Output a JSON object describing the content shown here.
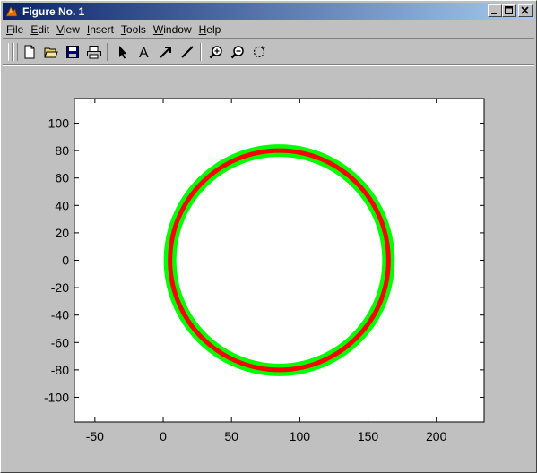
{
  "window": {
    "title": "Figure No. 1",
    "title_gradient": [
      "#0a246a",
      "#a6caf0"
    ],
    "controls": [
      {
        "name": "minimize",
        "icon": "minimize-icon"
      },
      {
        "name": "maximize",
        "icon": "maximize-icon"
      },
      {
        "name": "close",
        "icon": "close-icon"
      }
    ]
  },
  "menubar": {
    "items": [
      {
        "label": "File",
        "underline": "F",
        "rest": "ile"
      },
      {
        "label": "Edit",
        "underline": "E",
        "rest": "dit"
      },
      {
        "label": "View",
        "underline": "V",
        "rest": "iew"
      },
      {
        "label": "Insert",
        "underline": "I",
        "rest": "nsert"
      },
      {
        "label": "Tools",
        "underline": "T",
        "rest": "ools"
      },
      {
        "label": "Window",
        "underline": "W",
        "rest": "indow"
      },
      {
        "label": "Help",
        "underline": "H",
        "rest": "elp"
      }
    ]
  },
  "toolbar": {
    "tools": [
      "new-file-icon",
      "open-folder-icon",
      "save-icon",
      "print-icon",
      "select-arrow-icon",
      "text-icon",
      "arrow-icon",
      "line-icon",
      "zoom-in-icon",
      "zoom-out-icon",
      "rotate-icon"
    ]
  },
  "chart_data": {
    "type": "line",
    "title": "",
    "xlabel": "",
    "ylabel": "",
    "xlim": [
      -65,
      235
    ],
    "ylim": [
      -118,
      118
    ],
    "xticks": [
      -50,
      0,
      50,
      100,
      150,
      200
    ],
    "yticks": [
      -100,
      -80,
      -60,
      -40,
      -20,
      0,
      20,
      40,
      60,
      80,
      100
    ],
    "grid": false,
    "series": [
      {
        "shape": "circle",
        "center": [
          85,
          0
        ],
        "radius": 80,
        "color": "#00ff00",
        "linewidth": "thick"
      },
      {
        "shape": "circle",
        "center": [
          85,
          0
        ],
        "radius": 80,
        "color": "#ff0000",
        "linewidth": "medium"
      }
    ]
  }
}
